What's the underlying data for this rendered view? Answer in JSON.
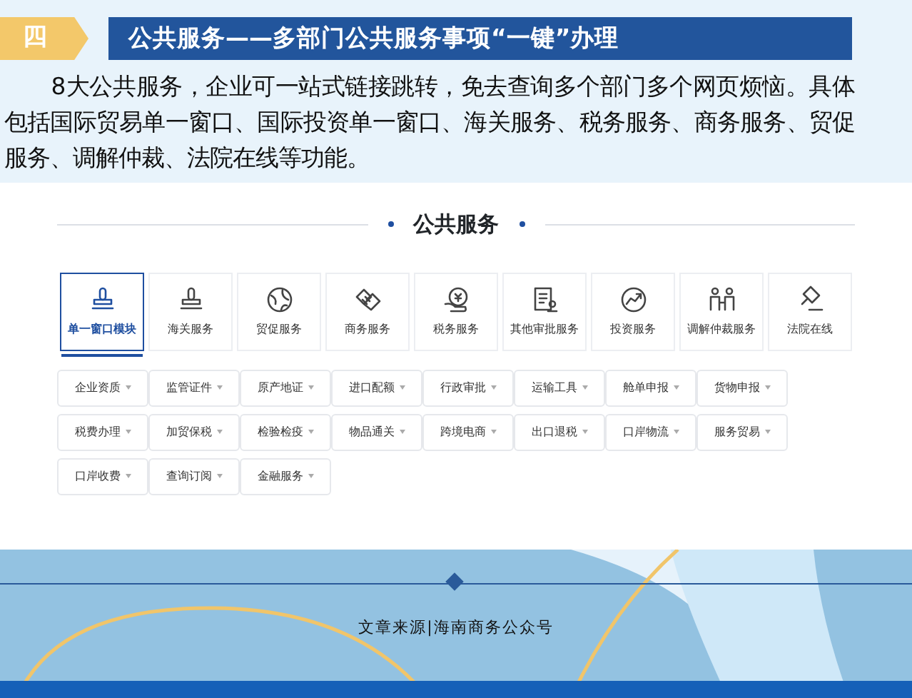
{
  "header": {
    "badge": "四",
    "title": "公共服务——多部门公共服务事项“一键”办理"
  },
  "intro": "8大公共服务，企业可一站式链接跳转，免去查询多个部门多个网页烦恼。具体包括国际贸易单一窗口、国际投资单一窗口、海关服务、税务服务、商务服务、贸促服务、调解仲裁、法院在线等功能。",
  "section_title": "公共服务",
  "service_tabs": [
    {
      "label": "单一窗口模块",
      "kind": "stamp",
      "selected": true
    },
    {
      "label": "海关服务",
      "kind": "stamp",
      "selected": false
    },
    {
      "label": "贸促服务",
      "kind": "globe",
      "selected": false
    },
    {
      "label": "商务服务",
      "kind": "handshake",
      "selected": false
    },
    {
      "label": "税务服务",
      "kind": "coin",
      "selected": false
    },
    {
      "label": "其他审批服务",
      "kind": "document",
      "selected": false
    },
    {
      "label": "投资服务",
      "kind": "chart",
      "selected": false
    },
    {
      "label": "调解仲裁服务",
      "kind": "people",
      "selected": false
    },
    {
      "label": "法院在线",
      "kind": "gavel",
      "selected": false
    }
  ],
  "filters": [
    {
      "label": "企业资质"
    },
    {
      "label": "监管证件"
    },
    {
      "label": "原产地证"
    },
    {
      "label": "进口配额"
    },
    {
      "label": "行政审批"
    },
    {
      "label": "运输工具"
    },
    {
      "label": "舱单申报"
    },
    {
      "label": "货物申报"
    },
    {
      "label": "税费办理"
    },
    {
      "label": "加贸保税"
    },
    {
      "label": "检验检疫"
    },
    {
      "label": "物品通关"
    },
    {
      "label": "跨境电商"
    },
    {
      "label": "出口退税"
    },
    {
      "label": "口岸物流"
    },
    {
      "label": "服务贸易"
    },
    {
      "label": "口岸收费"
    },
    {
      "label": "查询订阅"
    },
    {
      "label": "金融服务"
    }
  ],
  "footer": {
    "source": "文章来源|海南商务公众号"
  }
}
